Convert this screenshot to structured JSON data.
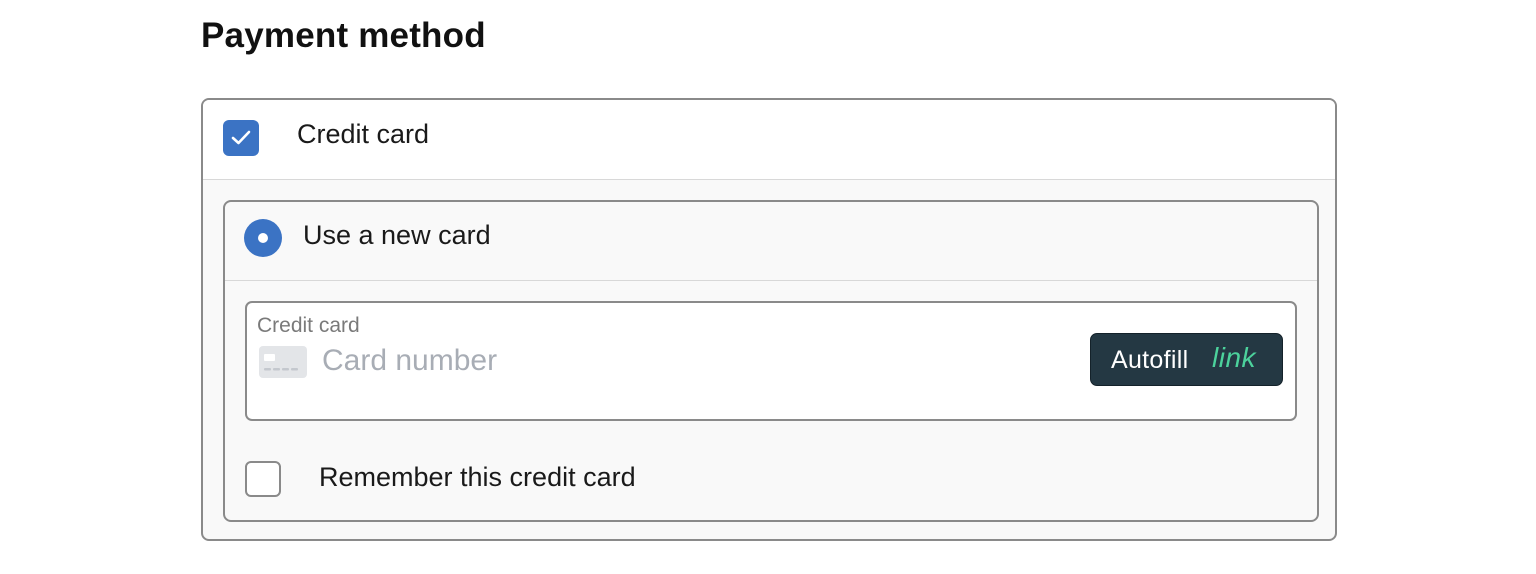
{
  "page": {
    "title": "Payment method"
  },
  "payment_option": {
    "label": "Credit card",
    "checked": true
  },
  "card_choice": {
    "label": "Use a new card",
    "selected": true
  },
  "card_field": {
    "label": "Credit card",
    "placeholder": "Card number",
    "value": "",
    "card_icon": "credit-card-icon"
  },
  "autofill": {
    "label": "Autofill",
    "brand": "link",
    "background_color": "#243843",
    "brand_color": "#4cd29c"
  },
  "remember": {
    "label": "Remember this credit card",
    "checked": false
  },
  "colors": {
    "accent": "#3b73c4",
    "border": "#8a8a8a",
    "placeholder": "#a8adb5"
  }
}
